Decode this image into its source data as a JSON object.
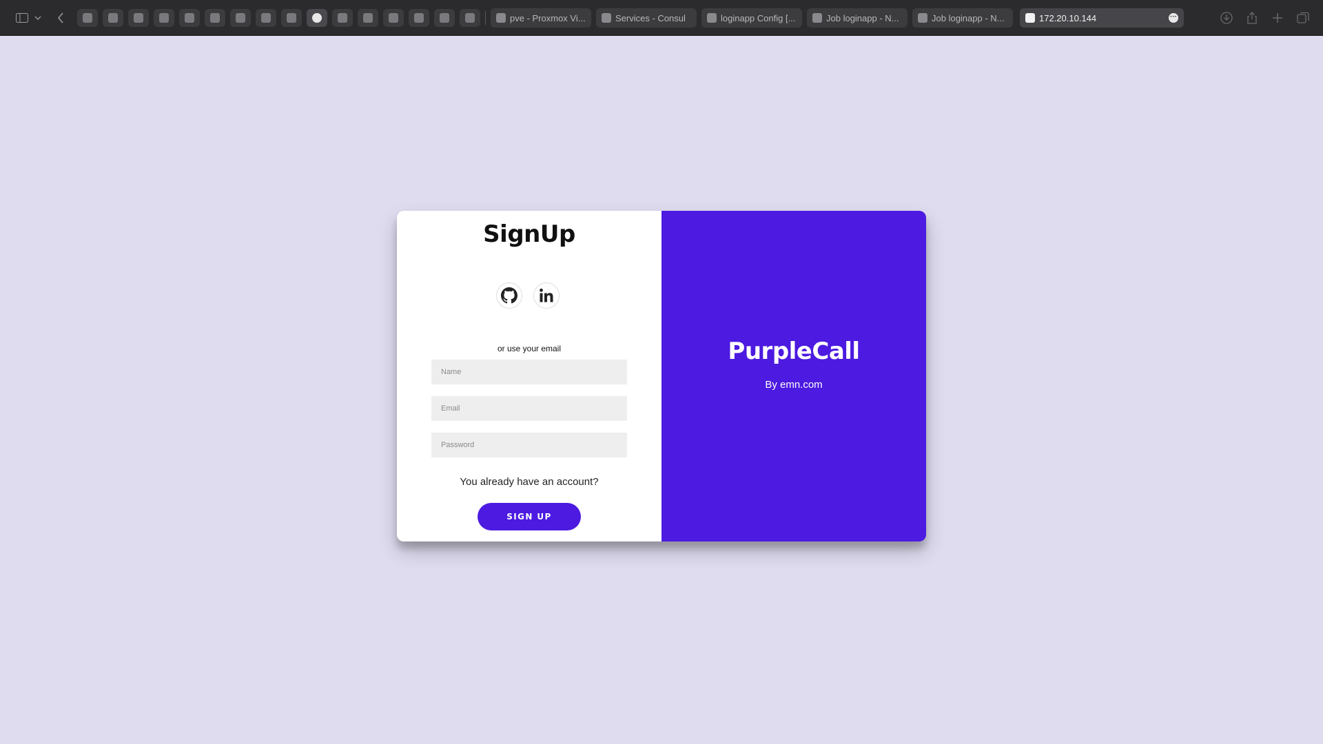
{
  "browser": {
    "pinned_tabs": [
      {
        "name": "pinned-tab-1"
      },
      {
        "name": "pinned-tab-2"
      },
      {
        "name": "pinned-tab-3"
      },
      {
        "name": "pinned-tab-4"
      },
      {
        "name": "pinned-tab-5"
      },
      {
        "name": "pinned-tab-6"
      },
      {
        "name": "pinned-tab-7"
      },
      {
        "name": "pinned-tab-8"
      },
      {
        "name": "pinned-tab-9"
      },
      {
        "name": "pinned-tab-github"
      },
      {
        "name": "pinned-tab-11"
      },
      {
        "name": "pinned-tab-12"
      },
      {
        "name": "pinned-tab-13"
      },
      {
        "name": "pinned-tab-14"
      },
      {
        "name": "pinned-tab-15"
      },
      {
        "name": "pinned-tab-16"
      }
    ],
    "tabs": [
      {
        "title": "pve - Proxmox Vi..."
      },
      {
        "title": "Services - Consul"
      },
      {
        "title": "loginapp Config [..."
      },
      {
        "title": "Job loginapp - N..."
      },
      {
        "title": "Job loginapp - N..."
      }
    ],
    "active_tab": {
      "address": "172.20.10.144"
    }
  },
  "form": {
    "title": "SignUp",
    "email_hint": "or use your email",
    "name_placeholder": "Name",
    "email_placeholder": "Email",
    "password_placeholder": "Password",
    "account_text": "You already have an account?",
    "submit_label": "SIGN UP"
  },
  "social": [
    {
      "icon": "github-icon"
    },
    {
      "icon": "linkedin-icon"
    }
  ],
  "overlay": {
    "title": "PurpleCall",
    "subtitle": "By emn.com"
  },
  "colors": {
    "accent": "#4c1ae0",
    "page_background": "#e0dcf0",
    "toolbar": "#2b2b2d"
  }
}
